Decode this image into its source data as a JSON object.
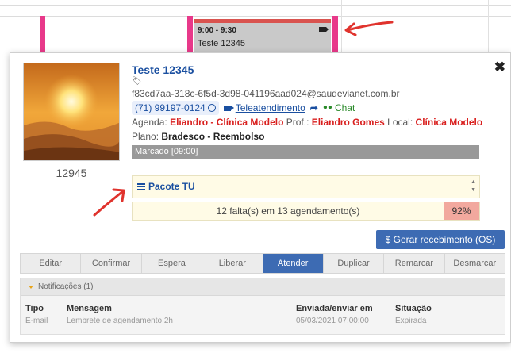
{
  "calendar": {
    "event": {
      "time": "9:00 - 9:30",
      "title": "Teste 12345"
    }
  },
  "popup": {
    "patient": {
      "name": "Teste 12345",
      "email": "f83cd7aa-318c-6f5d-3d98-041196aad024@saudevianet.com.br",
      "phone": "(71) 99197-0124",
      "teleatendimento": "Teleatendimento",
      "chat": "Chat",
      "id": "12945"
    },
    "agenda": {
      "agenda_label": "Agenda:",
      "agenda_value": "Eliandro - Clínica Modelo",
      "prof_label": "Prof.:",
      "prof_value": "Eliandro Gomes",
      "local_label": "Local:",
      "local_value": "Clínica Modelo"
    },
    "plano": {
      "label": "Plano:",
      "value": "Bradesco - Reembolso"
    },
    "status": "Marcado [09:00]",
    "pacote": {
      "label": "Pacote TU"
    },
    "faltas": {
      "text": "12 falta(s) em 13 agendamento(s)",
      "percent": "92%"
    },
    "gerar_button": "$ Gerar recebimento (OS)",
    "actions": [
      "Editar",
      "Confirmar",
      "Espera",
      "Liberar",
      "Atender",
      "Duplicar",
      "Remarcar",
      "Desmarcar"
    ],
    "active_action": "Atender",
    "notifications": {
      "title": "Notificações (1)",
      "headers": {
        "tipo": "Tipo",
        "mensagem": "Mensagem",
        "enviada": "Enviada/enviar em",
        "situacao": "Situação"
      },
      "rows": [
        {
          "tipo": "E-mail",
          "mensagem": "Lembrete de agendamento 2h",
          "enviada": "05/03/2021 07:00:00",
          "situacao": "Expirada"
        }
      ]
    }
  },
  "colors": {
    "accent": "#3d6bb3",
    "pink": "#e8398a",
    "red": "#d9201f",
    "arrow": "#e0332d"
  }
}
